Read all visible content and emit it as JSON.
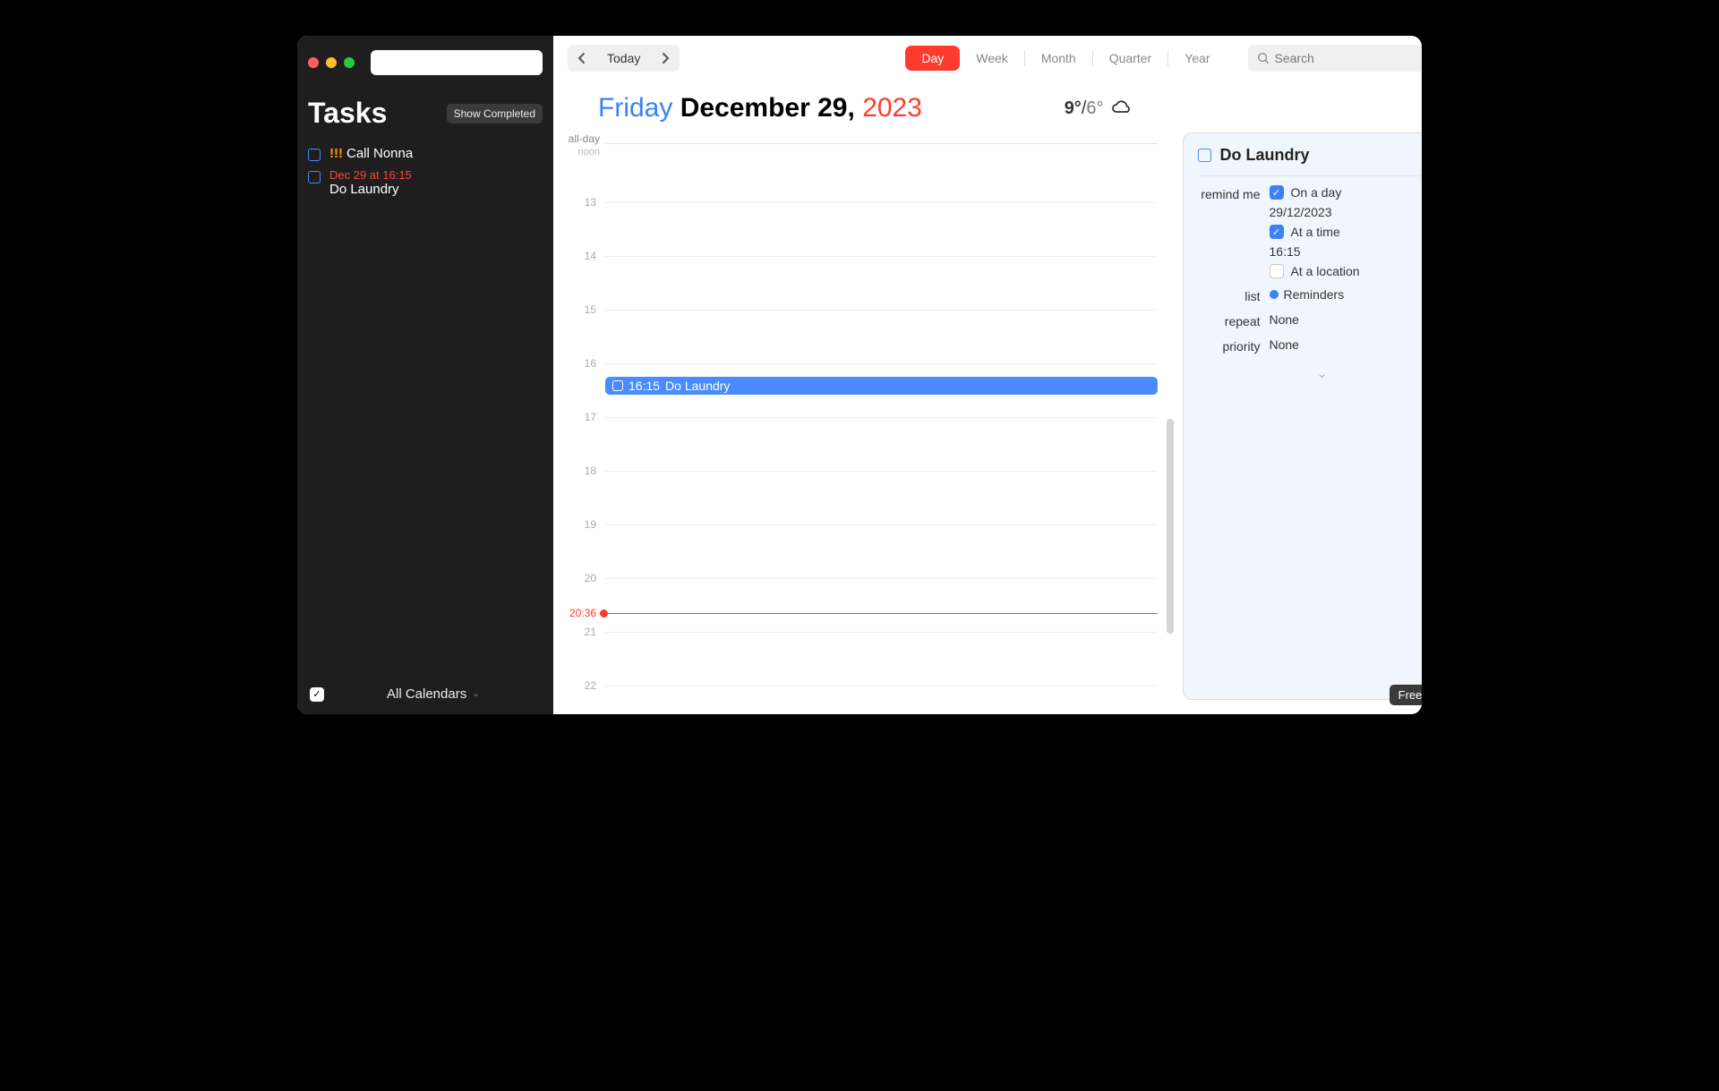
{
  "sidebar": {
    "title": "Tasks",
    "show_completed_label": "Show Completed",
    "search_value": "",
    "tasks": [
      {
        "priority": "!!!",
        "title": "Call Nonna",
        "due": ""
      },
      {
        "priority": "",
        "title": "Do Laundry",
        "due": "Dec 29 at 16:15"
      }
    ],
    "footer": {
      "all_calendars_label": "All Calendars"
    }
  },
  "toolbar": {
    "today_label": "Today",
    "views": {
      "day": "Day",
      "week": "Week",
      "month": "Month",
      "quarter": "Quarter",
      "year": "Year"
    },
    "search_placeholder": "Search"
  },
  "date": {
    "dayname": "Friday",
    "month_day": "December 29",
    "comma": ",",
    "year": "2023"
  },
  "weather": {
    "hi": "9°",
    "slash": "/",
    "lo": "6°"
  },
  "timeline": {
    "allday_label": "all-day",
    "noon_label": "noon",
    "hours": [
      "13",
      "14",
      "15",
      "16",
      "17",
      "18",
      "19",
      "20",
      "21",
      "22"
    ],
    "event": {
      "time": "16:15",
      "title": "Do Laundry"
    },
    "now_time": "20:36"
  },
  "detail": {
    "title": "Do Laundry",
    "rows": {
      "remindme_label": "remind me",
      "onaday_label": "On a day",
      "onaday_value": "29/12/2023",
      "atatime_label": "At a time",
      "atatime_value": "16:15",
      "atlocation_label": "At a location",
      "list_label": "list",
      "list_value": "Reminders",
      "repeat_label": "repeat",
      "repeat_value": "None",
      "priority_label": "priority",
      "priority_value": "None"
    }
  },
  "free_mode_label": "Free Mode"
}
